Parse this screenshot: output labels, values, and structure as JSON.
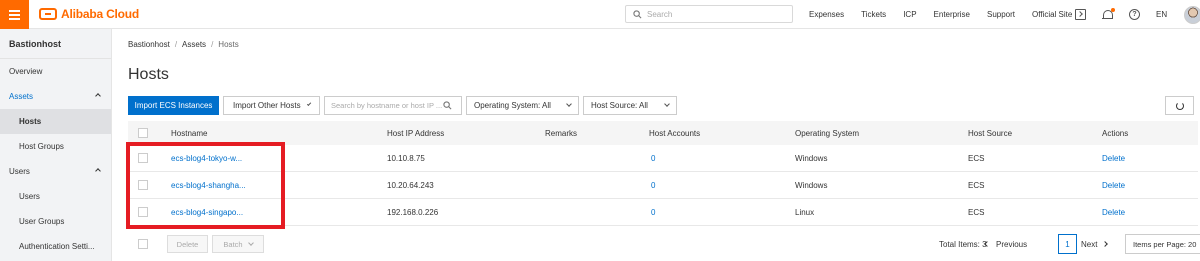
{
  "topbar": {
    "brand": "Alibaba Cloud",
    "search_placeholder": "Search",
    "links": [
      "Expenses",
      "Tickets",
      "ICP",
      "Enterprise",
      "Support",
      "Official Site"
    ],
    "language": "EN",
    "help_glyph": "?",
    "accent_color": "#ff6a00"
  },
  "sidebar": {
    "title": "Bastionhost",
    "overview": "Overview",
    "assets": "Assets",
    "hosts": "Hosts",
    "host_groups": "Host Groups",
    "users": "Users",
    "users_sub": "Users",
    "user_groups": "User Groups",
    "auth_settings": "Authentication Setti..."
  },
  "breadcrumb": {
    "items": [
      "Bastionhost",
      "Assets",
      "Hosts"
    ],
    "separator": "/"
  },
  "page": {
    "title": "Hosts"
  },
  "toolbar": {
    "import_ecs": "Import ECS Instances",
    "import_other": "Import Other Hosts",
    "search_placeholder": "Search by hostname or host IP ...",
    "os_filter": "Operating System: All",
    "source_filter": "Host Source: All",
    "primary_color": "#0070cc"
  },
  "table": {
    "columns": [
      "Hostname",
      "Host IP Address",
      "Remarks",
      "Host Accounts",
      "Operating System",
      "Host Source",
      "Actions"
    ],
    "rows": [
      {
        "hostname": "ecs-blog4-tokyo-w...",
        "ip": "10.10.8.75",
        "remarks": "",
        "accounts": "0",
        "os": "Windows",
        "source": "ECS",
        "action": "Delete"
      },
      {
        "hostname": "ecs-blog4-shangha...",
        "ip": "10.20.64.243",
        "remarks": "",
        "accounts": "0",
        "os": "Windows",
        "source": "ECS",
        "action": "Delete"
      },
      {
        "hostname": "ecs-blog4-singapo...",
        "ip": "192.168.0.226",
        "remarks": "",
        "accounts": "0",
        "os": "Linux",
        "source": "ECS",
        "action": "Delete"
      }
    ]
  },
  "footer": {
    "delete": "Delete",
    "batch": "Batch",
    "total": "Total Items: 3",
    "prev": "Previous",
    "page": "1",
    "next": "Next",
    "per_page": "Items per Page: 20"
  },
  "highlight_color": "#e51c23"
}
